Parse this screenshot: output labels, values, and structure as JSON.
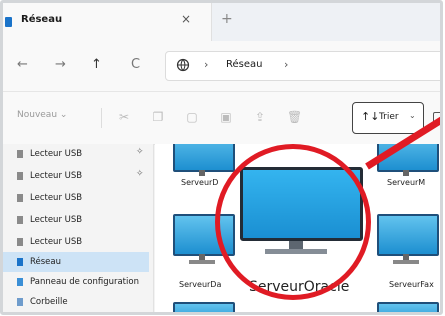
{
  "window": {
    "tab_title": "Réseau",
    "tab_close_glyph": "×",
    "new_tab_glyph": "+"
  },
  "navigation": {
    "back_glyph": "←",
    "forward_glyph": "→",
    "up_glyph": "↑",
    "refresh_glyph": "C",
    "separator_glyph": "›",
    "address_label": "Réseau"
  },
  "commandbar": {
    "new_label": "Nouveau ⌄",
    "sort_label": "Trier",
    "sort_chevron": "⌄",
    "sort_icon_glyph": "↑↓"
  },
  "sidebar": {
    "items": [
      {
        "label": "Lecteur USB",
        "pinned": true
      },
      {
        "label": "Lecteur USB",
        "pinned": true
      },
      {
        "label": "Lecteur USB",
        "pinned": false
      },
      {
        "label": "Lecteur USB",
        "pinned": false
      },
      {
        "label": "Lecteur USB",
        "pinned": false
      },
      {
        "label": "Réseau",
        "pinned": false,
        "selected": true
      },
      {
        "label": "Panneau de configuration",
        "pinned": false
      },
      {
        "label": "Corbeille",
        "pinned": false
      }
    ],
    "pin_glyph": "📌"
  },
  "content": {
    "computers": [
      {
        "label": "ServeurD"
      },
      {
        "label": "ServeurM"
      },
      {
        "label": "ServeurDa"
      },
      {
        "label": "ServeurFax"
      }
    ],
    "highlighted_label": "ServeurOracle"
  },
  "colors": {
    "highlight": "#e01b24",
    "selection": "#cde3f6",
    "monitor_blue": "#1a8fd2"
  }
}
